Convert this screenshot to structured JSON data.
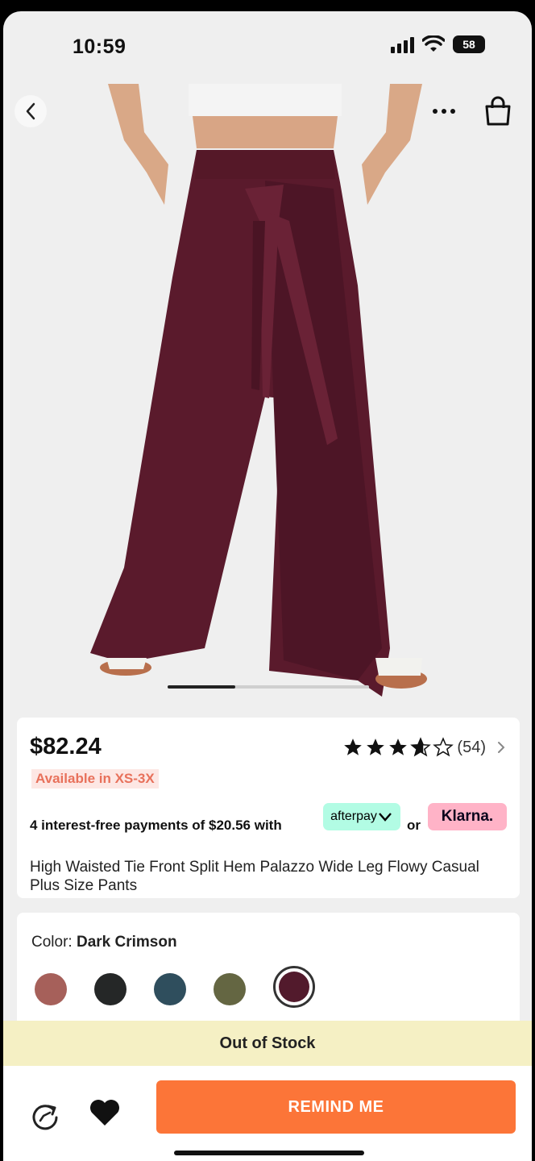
{
  "status_bar": {
    "time": "10:59",
    "battery": "58"
  },
  "product": {
    "price": "$82.24",
    "availability": "Available in XS-3X",
    "rating": {
      "stars": 4.5,
      "max": 5,
      "count": "(54)"
    },
    "installments": "4 interest-free payments of $20.56 with",
    "afterpay_label": "afterpay",
    "or_text": "or",
    "klarna_label": "Klarna.",
    "title": "High Waisted Tie Front Split Hem Palazzo Wide Leg Flowy Casual Plus Size Pants"
  },
  "color": {
    "label": "Color:",
    "selected": "Dark Crimson",
    "swatches": [
      {
        "name": "Rose",
        "hex": "#a6605a"
      },
      {
        "name": "Black",
        "hex": "#252727"
      },
      {
        "name": "Teal",
        "hex": "#2f4e5d"
      },
      {
        "name": "Olive",
        "hex": "#646642"
      },
      {
        "name": "Dark Crimson",
        "hex": "#521a2c"
      }
    ]
  },
  "carousel": {
    "active_index": 1,
    "total": 3
  },
  "stock_status": "Out of Stock",
  "actions": {
    "remind": "REMIND ME"
  },
  "colors": {
    "accent": "#fc7538",
    "pants": "#5a1a2c",
    "afterpay": "#b2fce4",
    "klarna": "#ffb3c7",
    "oos_bg": "#f5f0c4"
  }
}
